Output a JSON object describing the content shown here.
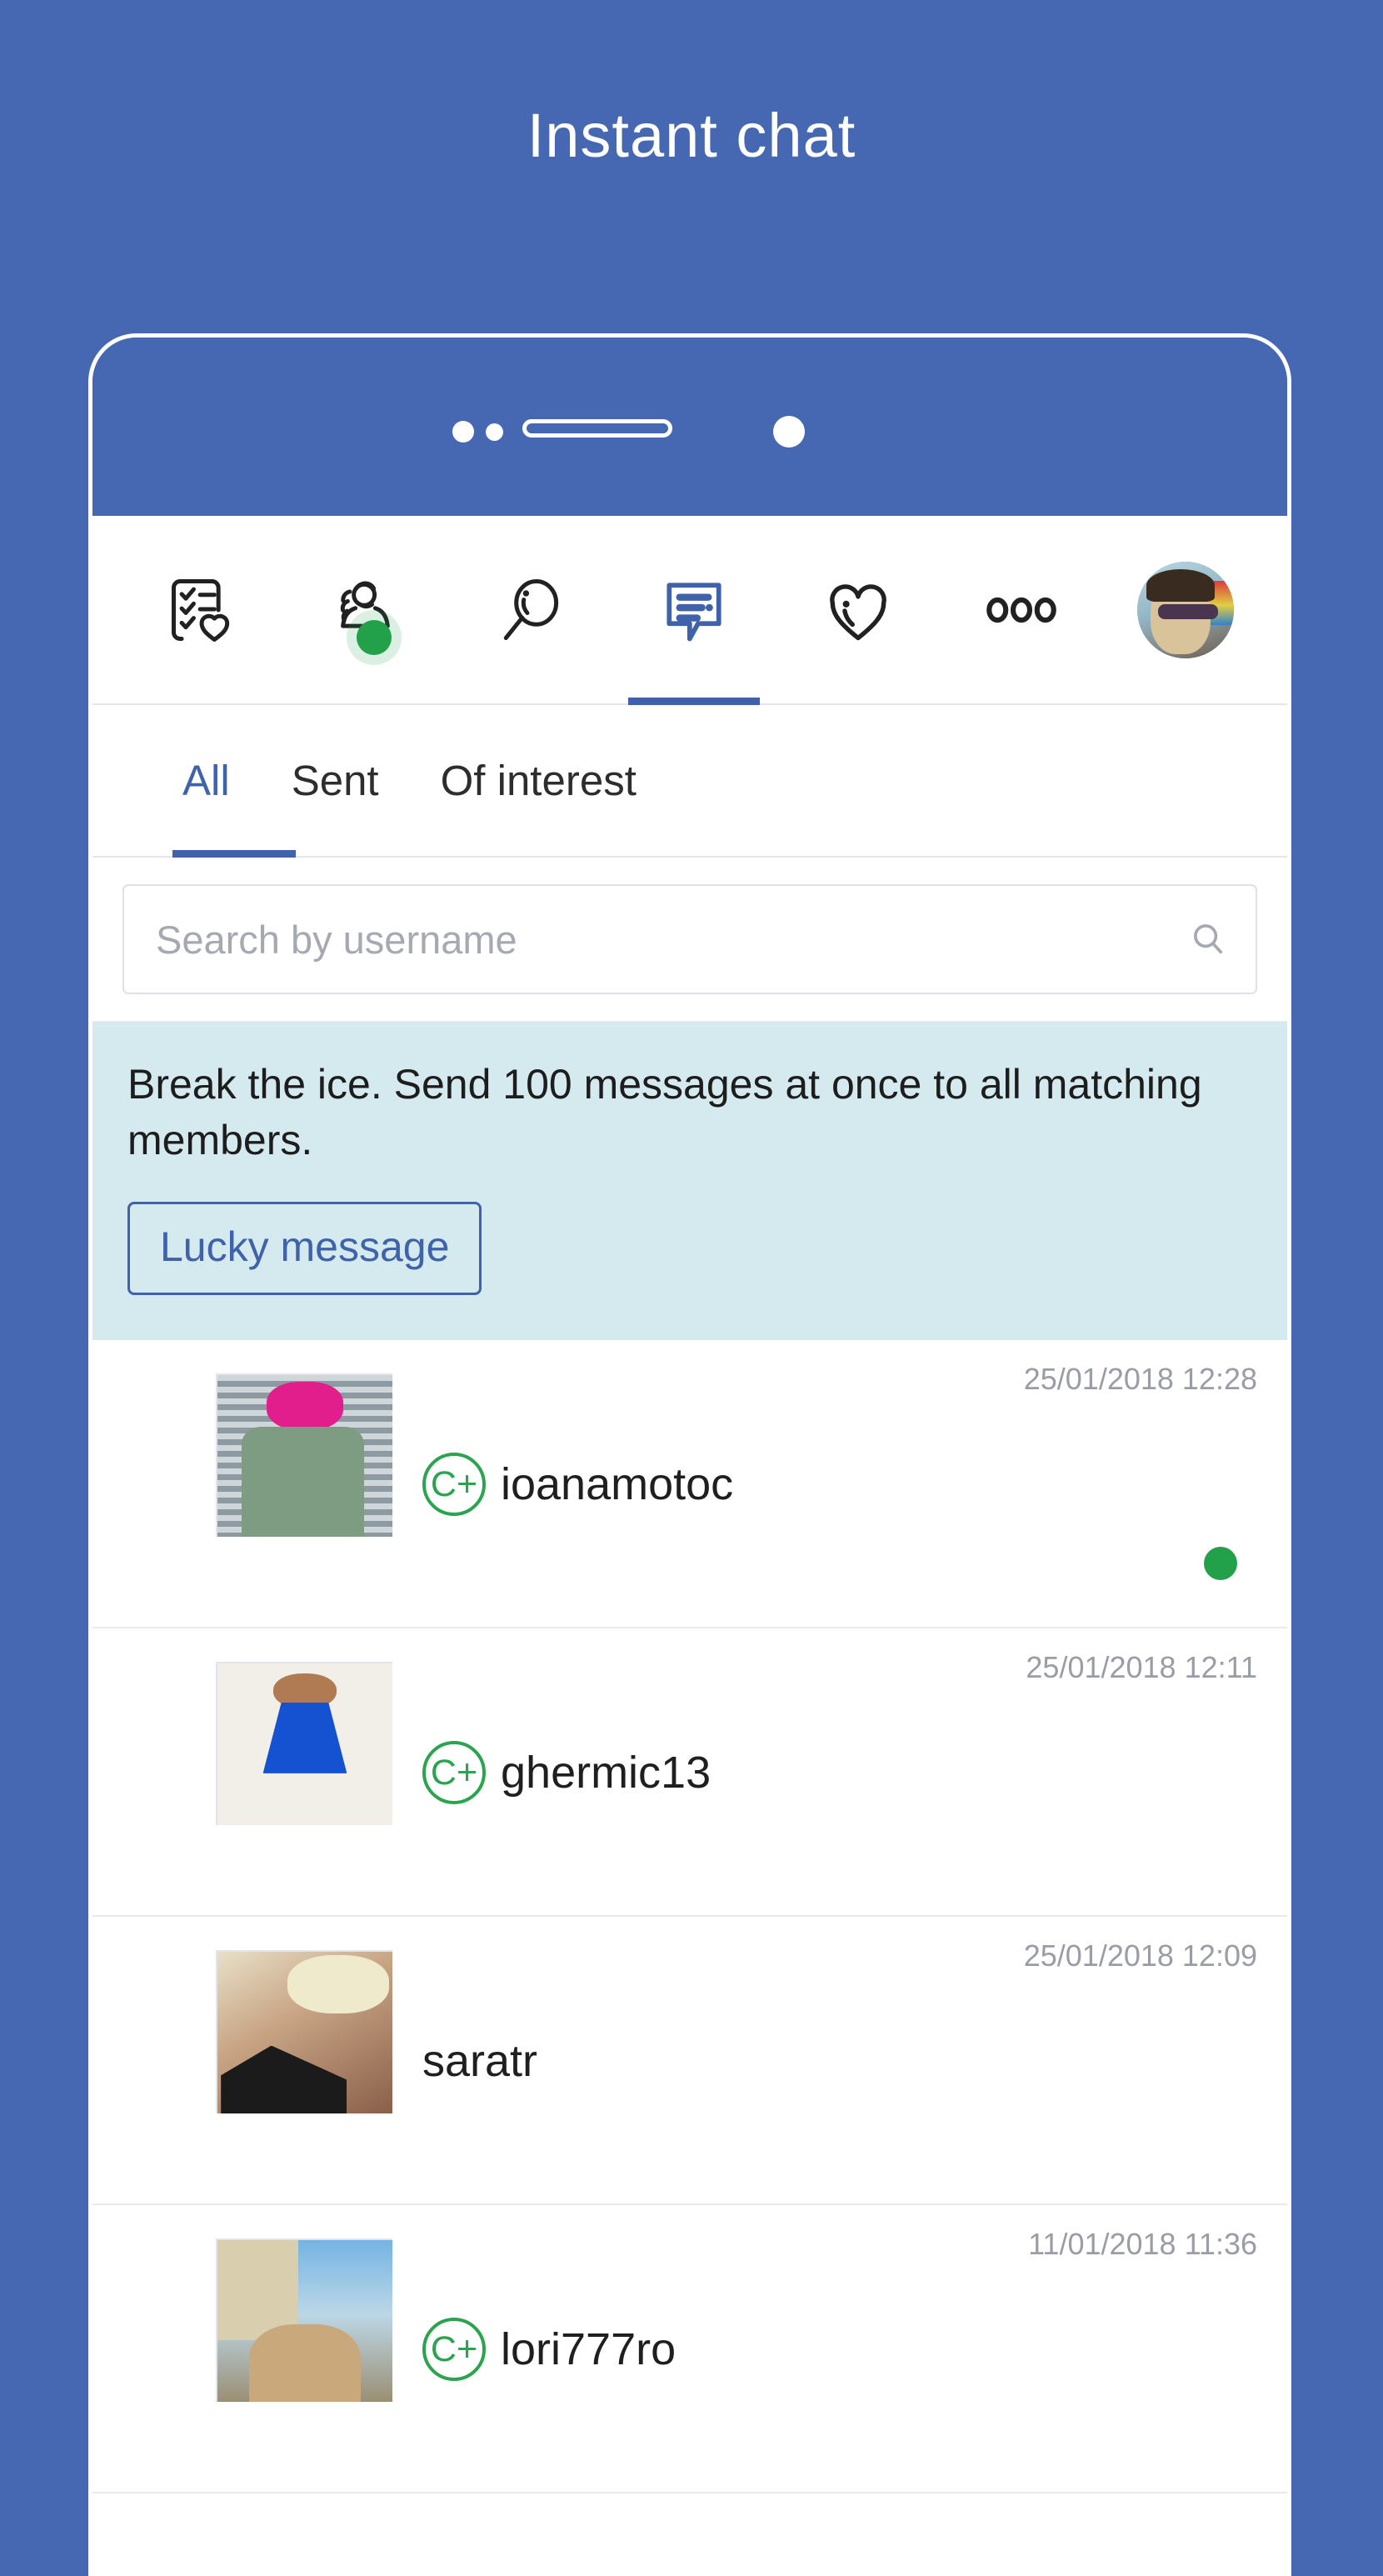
{
  "page": {
    "title": "Instant chat",
    "background_color": "#4668b3",
    "accent_color": "#3f62ab",
    "online_color": "#22a14a",
    "promo_background": "#d4eaef"
  },
  "iconbar": {
    "items": [
      {
        "name": "checklist-heart-icon",
        "label": "Lists",
        "active": false
      },
      {
        "name": "member-online-icon",
        "label": "Who is online",
        "active": false,
        "online": true
      },
      {
        "name": "search-icon",
        "label": "Search",
        "active": false
      },
      {
        "name": "chat-icon",
        "label": "Chat",
        "active": true
      },
      {
        "name": "heart-icon",
        "label": "Favourites",
        "active": false
      },
      {
        "name": "more-icon",
        "label": "More",
        "active": false
      },
      {
        "name": "profile-avatar",
        "label": "My profile",
        "active": false
      }
    ]
  },
  "tabs": [
    {
      "label": "All",
      "active": true
    },
    {
      "label": "Sent",
      "active": false
    },
    {
      "label": "Of interest",
      "active": false
    }
  ],
  "search": {
    "placeholder": "Search by username",
    "value": "",
    "icon": "search-icon"
  },
  "promo": {
    "text": "Break the ice. Send 100 messages at once to all matching members.",
    "button_label": "Lucky message"
  },
  "conversations": [
    {
      "username": "ioanamotoc",
      "timestamp": "25/01/2018 12:28",
      "badge": "C+",
      "has_badge": true,
      "online": true
    },
    {
      "username": "ghermic13",
      "timestamp": "25/01/2018 12:11",
      "badge": "C+",
      "has_badge": true,
      "online": false
    },
    {
      "username": "saratr",
      "timestamp": "25/01/2018 12:09",
      "badge": "",
      "has_badge": false,
      "online": false
    },
    {
      "username": "lori777ro",
      "timestamp": "11/01/2018 11:36",
      "badge": "C+",
      "has_badge": true,
      "online": false
    }
  ]
}
